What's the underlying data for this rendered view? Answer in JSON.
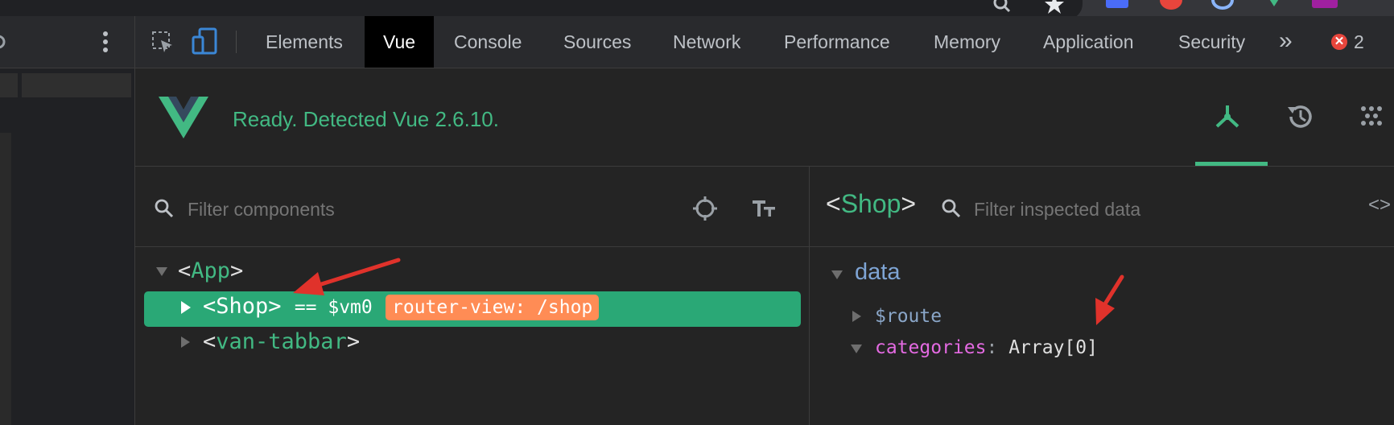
{
  "devtools": {
    "tabs": [
      "Elements",
      "Vue",
      "Console",
      "Sources",
      "Network",
      "Performance",
      "Memory",
      "Application",
      "Security"
    ],
    "more_tabs": "»",
    "error_count": "2"
  },
  "vue": {
    "status": "Ready. Detected Vue 2.6.10."
  },
  "components": {
    "filter_placeholder": "Filter components",
    "tree": {
      "app": "App",
      "shop": "Shop",
      "vm_ref": "== $vm0",
      "router_badge": "router-view: /shop",
      "tabbar": "van-tabbar"
    }
  },
  "inspector": {
    "component": "Shop",
    "filter_placeholder": "Filter inspected data",
    "section": "data",
    "fields": [
      {
        "key": "$route",
        "value": ""
      },
      {
        "key": "categories",
        "value": "Array[0]"
      }
    ]
  },
  "colors": {
    "vue_green": "#42b983",
    "selection": "#2aa876",
    "badge": "#ff8c55",
    "annotation_arrow": "#e0322b"
  }
}
